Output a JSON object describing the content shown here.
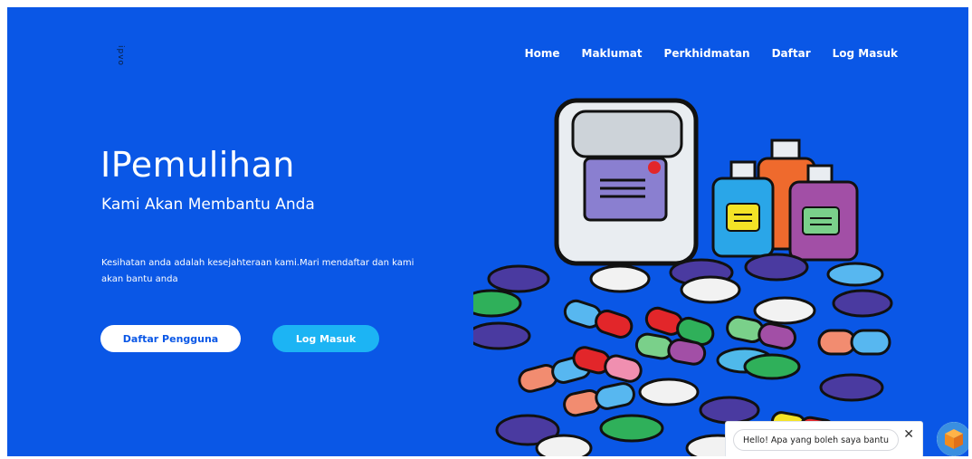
{
  "logo": {
    "text": "ipvo"
  },
  "nav": {
    "items": [
      "Home",
      "Maklumat",
      "Perkhidmatan",
      "Daftar",
      "Log Masuk"
    ]
  },
  "hero": {
    "title": "IPemulihan",
    "subtitle": "Kami Akan Membantu Anda",
    "description": "Kesihatan anda adalah kesejahteraan kami.Mari mendaftar dan kami akan bantu anda"
  },
  "buttons": {
    "register": "Daftar Pengguna",
    "login": "Log Masuk"
  },
  "chat": {
    "greeting": "Hello! Apa yang boleh saya bantu",
    "close": "✕"
  },
  "colors": {
    "background": "#0a57e6",
    "login_button": "#1cb4f4",
    "text": "#ffffff"
  },
  "icons": {
    "chat_avatar": "box-icon",
    "close": "close-icon"
  }
}
